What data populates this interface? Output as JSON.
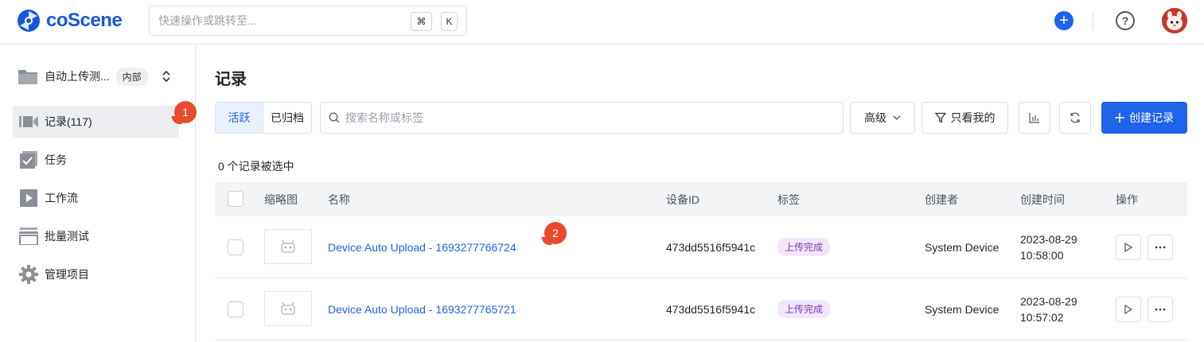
{
  "app": {
    "name": "coScene"
  },
  "topbar": {
    "search_placeholder": "快速操作或跳转至...",
    "shortcut_cmd": "⌘",
    "shortcut_key": "K",
    "add_label": "+",
    "help_label": "?"
  },
  "sidebar": {
    "project_name": "自动上传测...",
    "project_badge": "内部",
    "project_switch": "⌃⌄",
    "items": [
      {
        "label": "记录(117)",
        "icon": "camera-icon"
      },
      {
        "label": "任务",
        "icon": "task-icon"
      },
      {
        "label": "工作流",
        "icon": "play-icon"
      },
      {
        "label": "批量测试",
        "icon": "batch-icon"
      },
      {
        "label": "管理项目",
        "icon": "gear-icon"
      }
    ],
    "badge_1": "1"
  },
  "main": {
    "title": "记录",
    "tabs": [
      {
        "label": "活跃"
      },
      {
        "label": "已归档"
      }
    ],
    "search_placeholder": "搜索名称或标签",
    "advanced_label": "高级",
    "only_mine_label": "只看我的",
    "create_label": "创建记录",
    "selected_count": "0 个记录被选中",
    "badge_2": "2",
    "columns": {
      "thumbnail": "缩略图",
      "name": "名称",
      "device_id": "设备ID",
      "tags": "标签",
      "creator": "创建者",
      "created_at": "创建时间",
      "actions": "操作"
    },
    "rows": [
      {
        "name": "Device Auto Upload - 1693277766724",
        "device_id": "473dd5516f5941c",
        "tag": "上传完成",
        "creator": "System Device",
        "date": "2023-08-29",
        "time": "10:58:00"
      },
      {
        "name": "Device Auto Upload - 1693277765721",
        "device_id": "473dd5516f5941c",
        "tag": "上传完成",
        "creator": "System Device",
        "date": "2023-08-29",
        "time": "10:57:02"
      }
    ]
  },
  "colors": {
    "brand": "#1a56db",
    "primary": "#1e63e9",
    "badge": "#e94b2e",
    "tag_bg": "#f1e6fb",
    "tag_text": "#7a3bb7"
  }
}
